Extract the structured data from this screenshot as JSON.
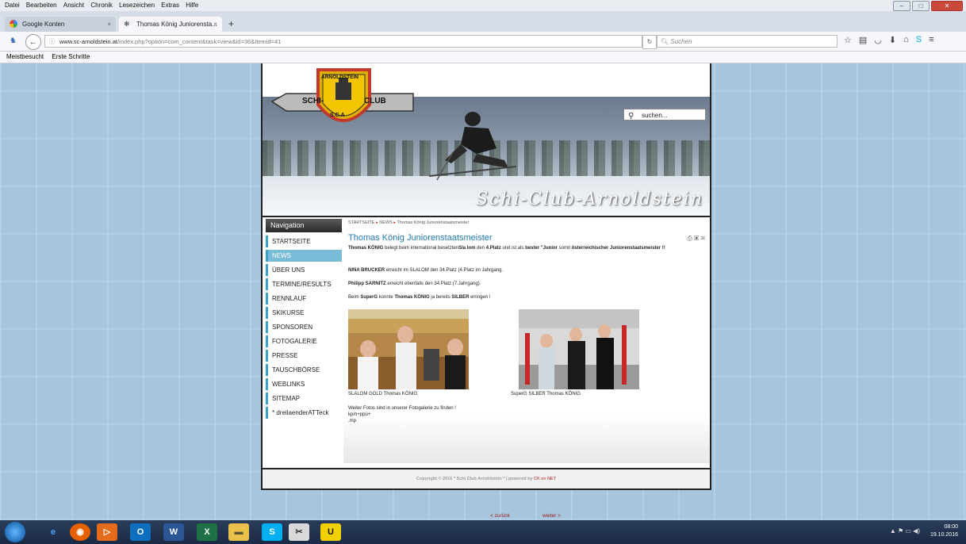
{
  "menubar": {
    "items": [
      "Datei",
      "Bearbeiten",
      "Ansicht",
      "Chronik",
      "Lesezeichen",
      "Extras",
      "Hilfe"
    ]
  },
  "tabs": [
    {
      "label": "Google Konten",
      "close": "×"
    },
    {
      "label": "Thomas König Juniorensta...",
      "close": "×"
    }
  ],
  "new_tab": "+",
  "url": {
    "domain": "www.sc-arnoldstein.at",
    "path": "/index.php?option=com_content&task=view&id=36&Itemid=41"
  },
  "browser_search": {
    "placeholder": "Suchen"
  },
  "bookmarks": {
    "items": [
      "Meistbesucht",
      "Erste Schritte"
    ]
  },
  "site": {
    "logo": {
      "top": "ARNOLDSTEIN",
      "left": "SCHI-",
      "right": "CLUB",
      "bottom": "S.C.A"
    },
    "header_title": "Schi-Club-Arnoldstein",
    "search_placeholder": "suchen...",
    "nav_heading": "Navigation",
    "nav": [
      {
        "label": "STARTSEITE",
        "active": false
      },
      {
        "label": "NEWS",
        "active": true
      },
      {
        "label": "ÜBER UNS",
        "active": false
      },
      {
        "label": "TERMINE/RESULTS",
        "active": false
      },
      {
        "label": "RENNLAUF",
        "active": false
      },
      {
        "label": "SKIKURSE",
        "active": false
      },
      {
        "label": "SPONSOREN",
        "active": false
      },
      {
        "label": "FOTOGALERIE",
        "active": false
      },
      {
        "label": "PRESSE",
        "active": false
      },
      {
        "label": "TAUSCHBÖRSE",
        "active": false
      },
      {
        "label": "WEBLINKS",
        "active": false
      },
      {
        "label": "SITEMAP",
        "active": false
      },
      {
        "label": "* dreilaenderATTeck",
        "active": false
      }
    ],
    "breadcrumb": [
      "STARTSEITE",
      "NEWS",
      "Thomas König Juniorenstaatsmeister"
    ],
    "article": {
      "title": "Thomas König Juniorenstaatsmeister",
      "p1_a": "Thomas KÖNIG",
      "p1_b": " belegt beim international besetzten",
      "p1_c": "Sla lom",
      "p1_d": " den ",
      "p1_e": "4.Platz",
      "p1_f": "  und ist als ",
      "p1_g": "bester \"Junior",
      "p1_h": " somit  ",
      "p1_i": "österreichischer Juniorenstaatsmeister !!",
      "p2_a": "NINA BRUCKER",
      "p2_b": " erreicht im SLALOM den 34.Platz (4.Platz im Jahrgang.",
      "p3_a": "Philipp SARNITZ",
      "p3_b": " erreicht ebenfalls den 34.Platz (7.Jahrgang).",
      "p4_a": "Beim ",
      "p4_b": "SuperG",
      "p4_c": " konnte ",
      "p4_d": "Thomas KÖNIG",
      "p4_e": " ja bereits ",
      "p4_f": "SILBER",
      "p4_g": " erringen !",
      "caption1": "SLALOM GOLD Thomas KÖNIG",
      "caption2": "SuperG SILBER Thomas KÖNIG",
      "more1": "Weiter Fotos sind in unserer Fotogalerie zu finden !",
      "more2": "kpm+ppü+",
      "more3": ".mp",
      "prev": "< zurück",
      "next": "weiter >"
    },
    "footer": {
      "copyright": "Copyright © 2016 * Schi Club Arnoldstein * | powered by ",
      "ck": "CK on NET"
    }
  },
  "taskbar": {
    "time": "08:00",
    "date": "19.10.2016"
  }
}
